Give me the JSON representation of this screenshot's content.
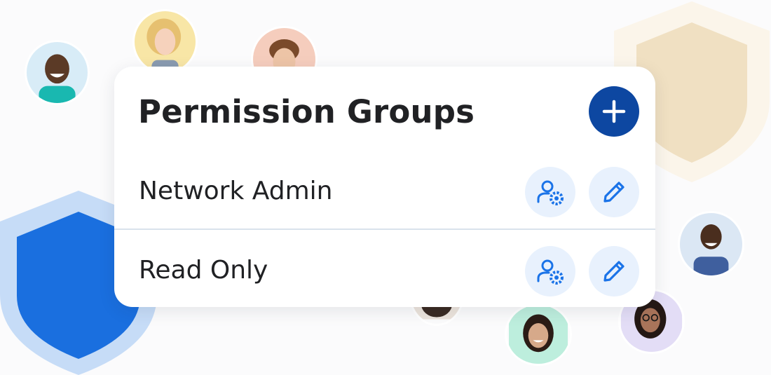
{
  "card": {
    "title": "Permission Groups",
    "add_icon": "plus-icon"
  },
  "groups": [
    {
      "name": "Network Admin",
      "manage_icon": "user-settings-icon",
      "edit_icon": "pencil-icon"
    },
    {
      "name": "Read Only",
      "manage_icon": "user-settings-icon",
      "edit_icon": "pencil-icon"
    }
  ],
  "colors": {
    "accent": "#0d47a1",
    "icon_blue": "#1a73e8",
    "icon_button_bg": "#e8f1fd",
    "shield_blue": "#1a6fdf",
    "shield_tan": "#f0e0c2"
  }
}
